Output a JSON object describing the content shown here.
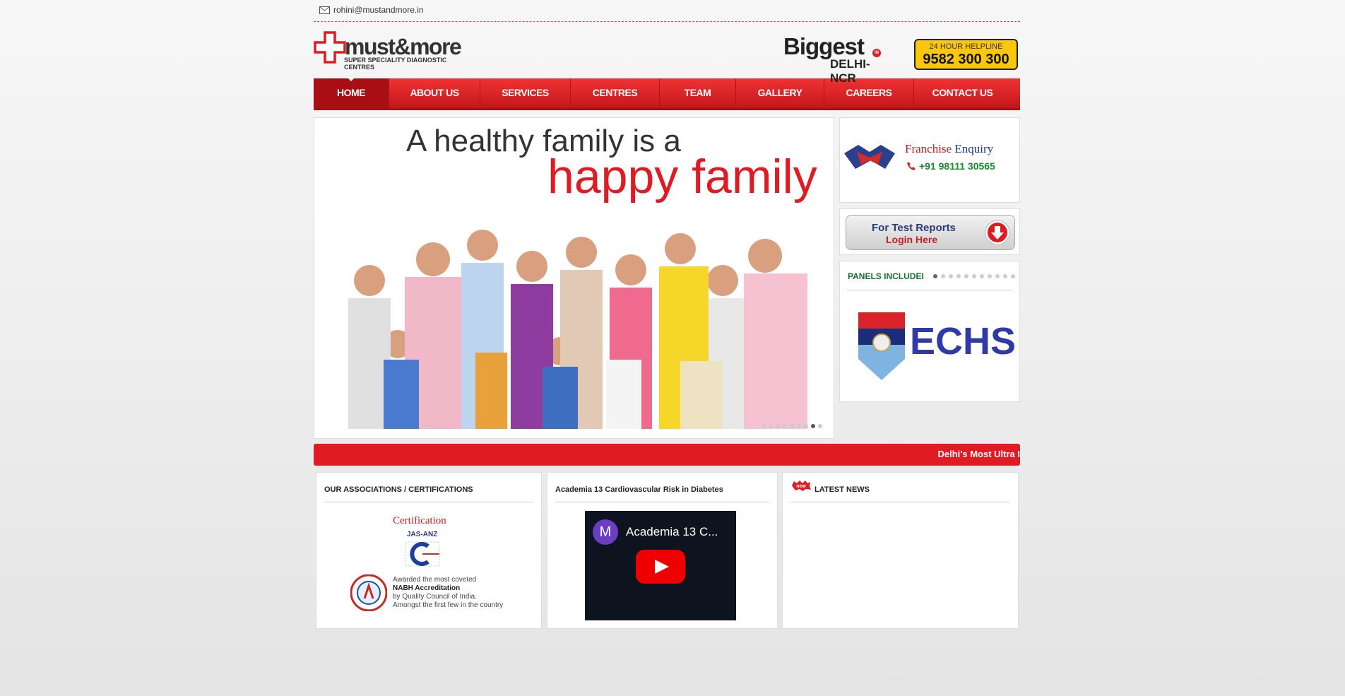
{
  "topbar": {
    "email": "rohini@mustandmore.in"
  },
  "logo": {
    "brand": "must&more",
    "tagline": "SUPER SPECIALITY DIAGNOSTIC CENTRES"
  },
  "badge": {
    "word": "Biggest",
    "in": "IN",
    "region": "DELHI-NCR"
  },
  "helpline": {
    "label": "24 HOUR HELPLINE",
    "number": "9582 300 300"
  },
  "nav": {
    "items": [
      "HOME",
      "ABOUT US",
      "SERVICES",
      "CENTRES",
      "TEAM",
      "GALLERY",
      "CAREERS",
      "CONTACT US"
    ]
  },
  "slider": {
    "line1": "A healthy family is a",
    "line2": "happy family",
    "slide_count": 9,
    "active_slide": 8
  },
  "franchise": {
    "word1": "Franchise",
    "word2": " Enquiry",
    "phone": "+91 98111 30565"
  },
  "test_reports": {
    "line1": "For Test Reports",
    "line2": "Login Here"
  },
  "panels": {
    "heading": "PANELS INCLUDEI",
    "dot_count": 11,
    "active_dot": 1,
    "logo_text": "ECHS"
  },
  "ticker": {
    "text": "Delhi's Most Ultra I"
  },
  "associations": {
    "heading": "OUR ASSOCIATIONS / CERTIFICATIONS",
    "cert_title": "Certification",
    "jas": "JAS-ANZ",
    "line1": "Awarded the most coveted",
    "line2": "NABH Accreditation",
    "line3": "by Quality Council of India.",
    "line4": "Amongst the first few in the country"
  },
  "video": {
    "heading": "Academia 13 Cardiovascular Risk in Diabetes",
    "avatar": "M",
    "title": "Academia 13 C..."
  },
  "news": {
    "heading": "LATEST NEWS",
    "badge": "new"
  },
  "colors": {
    "brand_red": "#e01b24",
    "helpline_yellow": "#fbc70a",
    "panel_green": "#1b6f33"
  }
}
